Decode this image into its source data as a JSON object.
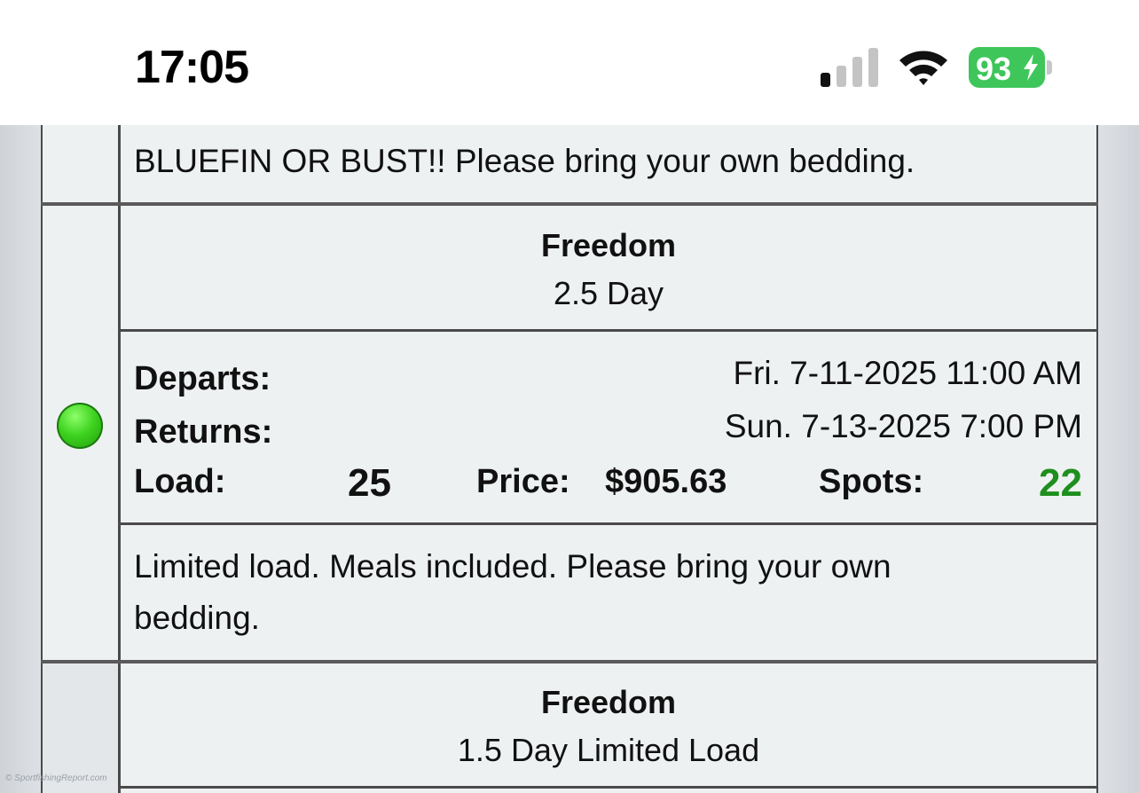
{
  "status_bar": {
    "time": "17:05",
    "battery_percent": "93",
    "signal_bars_active": 1,
    "signal_bars_total": 4,
    "icons": [
      "signal-icon",
      "wifi-icon",
      "battery-charging-icon"
    ],
    "battery_color": "#3fc65b"
  },
  "previous_trip": {
    "note": "BLUEFIN OR BUST!! Please bring your own bedding."
  },
  "trip": {
    "status_color": "#3ed21f",
    "status_icon": "green-status-dot-icon",
    "boat": "Freedom",
    "type": "2.5 Day",
    "departs_label": "Departs:",
    "departs_value": "Fri. 7-11-2025 11:00 AM",
    "returns_label": "Returns:",
    "returns_value": "Sun. 7-13-2025 7:00 PM",
    "load_label": "Load:",
    "load_value": "25",
    "price_label": "Price:",
    "price_value": "$905.63",
    "spots_label": "Spots:",
    "spots_value": "22",
    "spots_color": "#1e8f1e",
    "note": "Limited load. Meals included. Please bring your own bedding."
  },
  "next_trip": {
    "boat": "Freedom",
    "type": "1.5 Day Limited Load"
  },
  "watermark": "© SportfishingReport.com"
}
